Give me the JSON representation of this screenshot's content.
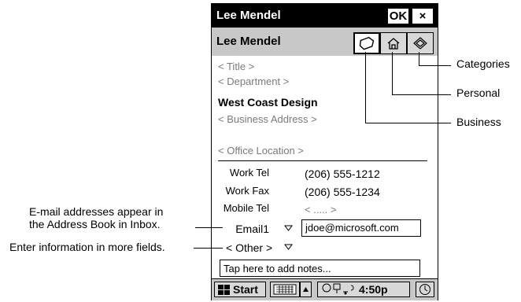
{
  "window": {
    "title": "Lee Mendel",
    "ok_label": "OK",
    "close_label": "×"
  },
  "contact": {
    "name": "Lee Mendel",
    "title_placeholder": "< Title >",
    "department_placeholder": "< Department >",
    "company": "West Coast Design",
    "business_address_placeholder": "< Business Address >",
    "office_location_placeholder": "< Office Location >"
  },
  "tabs": [
    {
      "name": "Business",
      "icon": "business-icon"
    },
    {
      "name": "Personal",
      "icon": "home-icon"
    },
    {
      "name": "Categories",
      "icon": "tag-icon"
    }
  ],
  "fields": {
    "work_tel_label": "Work Tel",
    "work_tel_value": "(206) 555-1212",
    "work_fax_label": "Work Fax",
    "work_fax_value": "(206) 555-1234",
    "mobile_tel_label": "Mobile Tel",
    "mobile_tel_value": "< ..... >",
    "email_label": "Email1",
    "email_value": "jdoe@microsoft.com",
    "other_label": "< Other >"
  },
  "notes_placeholder": "Tap here to add notes...",
  "taskbar": {
    "start_label": "Start",
    "time": "4:50p"
  },
  "callouts": {
    "categories": "Categories",
    "personal": "Personal",
    "business": "Business",
    "email_line1": "E-mail addresses appear in",
    "email_line2": "the Address Book in Inbox.",
    "more_fields": "Enter information in more fields."
  }
}
